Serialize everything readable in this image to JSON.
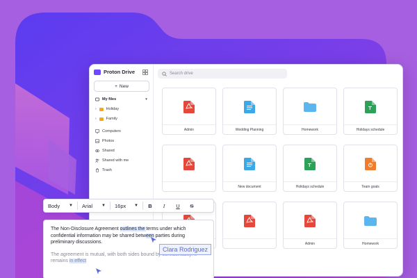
{
  "app": {
    "brand": "Proton Drive",
    "new_label": "New"
  },
  "search": {
    "placeholder": "Search drive"
  },
  "sidebar": {
    "my_files": "My files",
    "folders": [
      {
        "label": "Holiday"
      },
      {
        "label": "Family"
      }
    ],
    "items": [
      {
        "label": "Computers",
        "icon": "monitor-icon"
      },
      {
        "label": "Photos",
        "icon": "photo-icon"
      },
      {
        "label": "Shared",
        "icon": "link-icon"
      },
      {
        "label": "Shared with me",
        "icon": "users-icon"
      },
      {
        "label": "Trash",
        "icon": "trash-icon"
      }
    ]
  },
  "files": [
    {
      "name": "Admin",
      "type": "pdf",
      "color": "#e5483b"
    },
    {
      "name": "Wedding Planning",
      "type": "doc",
      "color": "#3da8e8"
    },
    {
      "name": "Homework",
      "type": "folder",
      "color": "#5bb6f0"
    },
    {
      "name": "Holidays schedule",
      "type": "sheet",
      "color": "#2ea05a"
    },
    {
      "name": "",
      "type": "pdf",
      "color": "#e5483b"
    },
    {
      "name": "New document",
      "type": "doc",
      "color": "#3da8e8"
    },
    {
      "name": "Holidays schedule",
      "type": "sheet",
      "color": "#2ea05a"
    },
    {
      "name": "Team goals",
      "type": "slides",
      "color": "#f07d2e"
    },
    {
      "name": "Admin",
      "type": "pdf",
      "color": "#e5483b"
    },
    {
      "name": "",
      "type": "pdf",
      "color": "#e5483b"
    },
    {
      "name": "Admin",
      "type": "pdf",
      "color": "#e5483b"
    },
    {
      "name": "Homework",
      "type": "folder",
      "color": "#5bb6f0"
    },
    {
      "name": "Holidays schedule",
      "type": "sheet",
      "color": "#2ea05a"
    }
  ],
  "toolbar": {
    "style": "Body",
    "font": "Arial",
    "size": "16px",
    "bold": "B",
    "italic": "I",
    "underline": "U",
    "strike": "S"
  },
  "editor": {
    "p1_before": "The Non-Disclosure Agreement ",
    "p1_hl": "outlines the ",
    "p1_mid": "terms under which confidential information may be shared betw",
    "p1_hl2": "een",
    "p1_after": " parties during preliminary discussions.",
    "p2_before": "The agreement is mutual, with both sides bound by confidentiality. It remains ",
    "p2_hl": "in effect"
  },
  "collaborator": {
    "name": "Clara Rodriguez"
  },
  "colors": {
    "brand": "#6d4aff",
    "background": "#a65fe0",
    "folder": "#f5a623"
  }
}
